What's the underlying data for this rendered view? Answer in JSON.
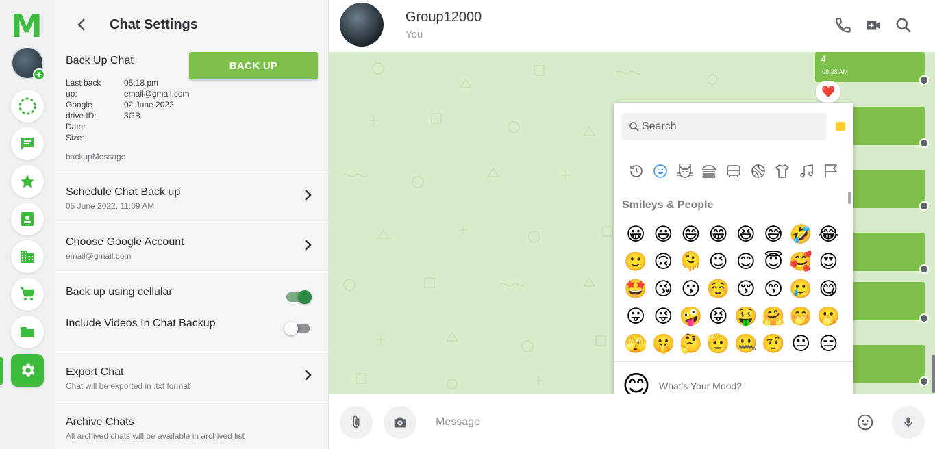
{
  "brand": {
    "logo_letter": "M",
    "accent": "#3cbb3c",
    "bubble_color": "#7cc04a",
    "chat_bg": "#d8eccb"
  },
  "rail": {
    "items": [
      {
        "icon": "status-ring-icon"
      },
      {
        "icon": "chat-icon"
      },
      {
        "icon": "star-icon"
      },
      {
        "icon": "contacts-icon"
      },
      {
        "icon": "building-icon"
      },
      {
        "icon": "cart-icon"
      },
      {
        "icon": "folder-icon"
      },
      {
        "icon": "gear-icon",
        "active": true
      }
    ]
  },
  "settings": {
    "title": "Chat Settings",
    "backup": {
      "title": "Back Up Chat",
      "button": "BACK UP",
      "labels": [
        "Last back",
        "up:",
        "Google",
        "drive ID:",
        "Date:",
        "Size:"
      ],
      "values": [
        "05:18 pm",
        "email@gmail.com",
        "02 June 2022",
        "3GB"
      ],
      "message": "backupMessage"
    },
    "schedule": {
      "title": "Schedule Chat Back up",
      "sub": "05 June 2022, 11:09 AM"
    },
    "google_account": {
      "title": "Choose Google Account",
      "sub": "email@gmail.com"
    },
    "cellular": {
      "title": "Back up using cellular",
      "enabled": true
    },
    "videos": {
      "title": "Include Videos In Chat Backup",
      "enabled": false
    },
    "export": {
      "title": "Export Chat",
      "sub": "Chat will be exported in .txt format"
    },
    "archive": {
      "title": "Archive Chats",
      "sub": "All archived chats will be available in archived list"
    }
  },
  "chat": {
    "name": "Group12000",
    "sub": "You",
    "messages": [
      {
        "text": "4",
        "time": "08:28 AM",
        "reaction": "❤️"
      }
    ]
  },
  "picker": {
    "search_placeholder": "Search",
    "categories": [
      "recent-icon",
      "smiley-icon",
      "animal-icon",
      "food-icon",
      "travel-icon",
      "activity-icon",
      "objects-icon",
      "music-icon",
      "flag-icon"
    ],
    "section_title": "Smileys & People",
    "emojis": [
      "😀",
      "😃",
      "😄",
      "😁",
      "😆",
      "😅",
      "🤣",
      "😂",
      "🙂",
      "🙃",
      "🫠",
      "😉",
      "😊",
      "😇",
      "🥰",
      "😍",
      "🤩",
      "😘",
      "😗",
      "☺️",
      "😚",
      "😙",
      "🥲",
      "😋",
      "😛",
      "😜",
      "🤪",
      "😝",
      "🤑",
      "🤗",
      "🤭",
      "🫢",
      "🫣",
      "🤫",
      "🤔",
      "🫡",
      "🤐",
      "🤨",
      "😐",
      "😑",
      "😶",
      "🫥",
      "😶",
      "😏",
      "😒",
      "🙄",
      "😬",
      "😮"
    ],
    "mood_emoji": "😊",
    "mood_text": "What's Your Mood?"
  },
  "composer": {
    "placeholder": "Message"
  }
}
